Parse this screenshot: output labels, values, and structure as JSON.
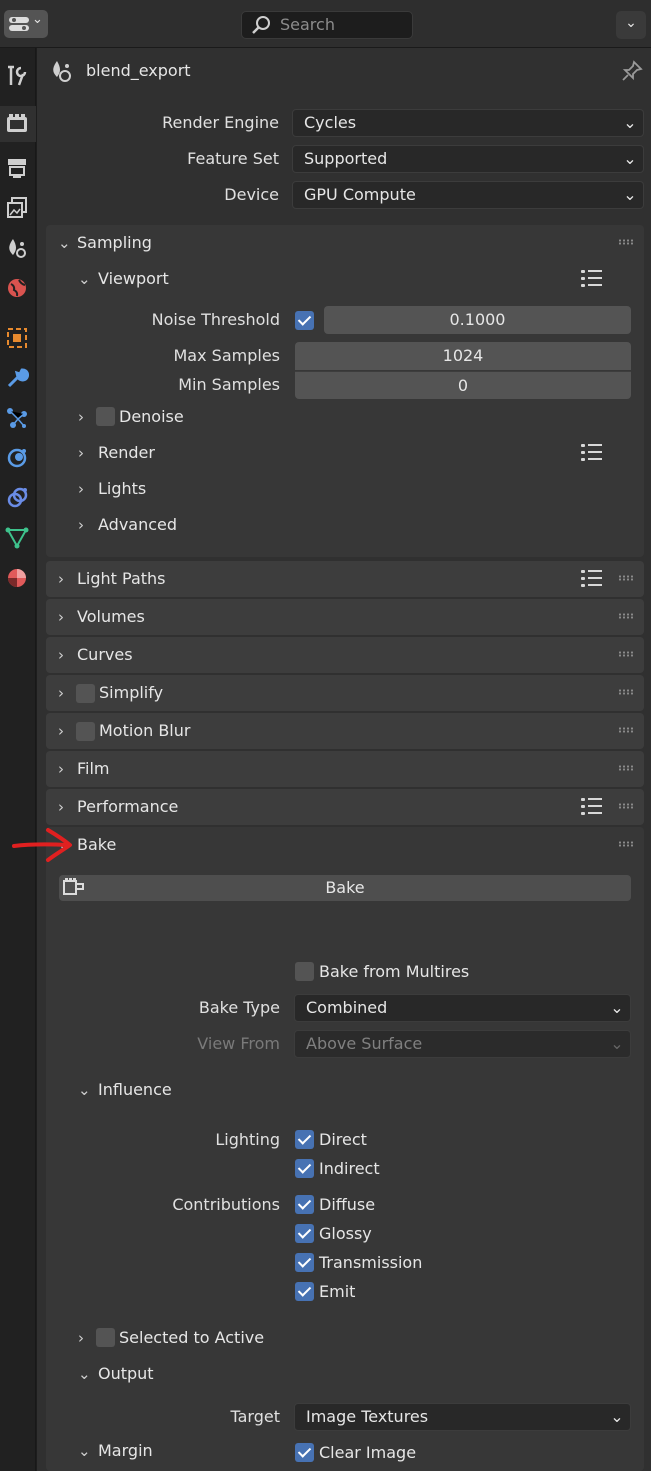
{
  "topbar": {
    "search_placeholder": "Search",
    "editor_type_icon": "properties-editor-icon"
  },
  "sidebar": {
    "tabs": [
      {
        "name": "tool-icon",
        "color": "#cfcfcf"
      },
      {
        "name": "render-icon",
        "color": "#cfcfcf",
        "active": true
      },
      {
        "name": "output-icon",
        "color": "#cfcfcf"
      },
      {
        "name": "view-layer-icon",
        "color": "#cfcfcf"
      },
      {
        "name": "scene-icon",
        "color": "#cfcfcf"
      },
      {
        "name": "world-icon",
        "color": "#d9534f"
      },
      {
        "name": "object-icon",
        "color": "#e88a2e"
      },
      {
        "name": "modifier-icon",
        "color": "#5a9be6"
      },
      {
        "name": "particles-icon",
        "color": "#5a9be6"
      },
      {
        "name": "physics-icon",
        "color": "#5a9be6"
      },
      {
        "name": "constraints-icon",
        "color": "#6a8ce6"
      },
      {
        "name": "data-icon",
        "color": "#3ec28c"
      },
      {
        "name": "material-icon",
        "color": "#e05a5a"
      }
    ]
  },
  "header": {
    "scene_name": "blend_export"
  },
  "render": {
    "engine_label": "Render Engine",
    "engine_value": "Cycles",
    "feature_set_label": "Feature Set",
    "feature_set_value": "Supported",
    "device_label": "Device",
    "device_value": "GPU Compute"
  },
  "sampling": {
    "title": "Sampling",
    "viewport": {
      "title": "Viewport",
      "noise_threshold_label": "Noise Threshold",
      "noise_threshold_value": "0.1000",
      "noise_threshold_enabled": true,
      "max_samples_label": "Max Samples",
      "max_samples_value": "1024",
      "min_samples_label": "Min Samples",
      "min_samples_value": "0"
    },
    "denoise_label": "Denoise",
    "render_label": "Render",
    "lights_label": "Lights",
    "advanced_label": "Advanced"
  },
  "panels": {
    "light_paths": "Light Paths",
    "volumes": "Volumes",
    "curves": "Curves",
    "simplify": "Simplify",
    "motion_blur": "Motion Blur",
    "film": "Film",
    "performance": "Performance",
    "bake": "Bake"
  },
  "bake": {
    "button_label": "Bake",
    "multires_label": "Bake from Multires",
    "bake_type_label": "Bake Type",
    "bake_type_value": "Combined",
    "view_from_label": "View From",
    "view_from_value": "Above Surface",
    "influence": {
      "title": "Influence",
      "lighting_label": "Lighting",
      "direct_label": "Direct",
      "indirect_label": "Indirect",
      "contributions_label": "Contributions",
      "diffuse_label": "Diffuse",
      "glossy_label": "Glossy",
      "transmission_label": "Transmission",
      "emit_label": "Emit"
    },
    "selected_to_active_label": "Selected to Active",
    "output": {
      "title": "Output",
      "target_label": "Target",
      "target_value": "Image Textures",
      "clear_image_label": "Clear Image"
    },
    "margin_title": "Margin"
  },
  "annotation": {
    "arrow_color": "#e02020"
  }
}
